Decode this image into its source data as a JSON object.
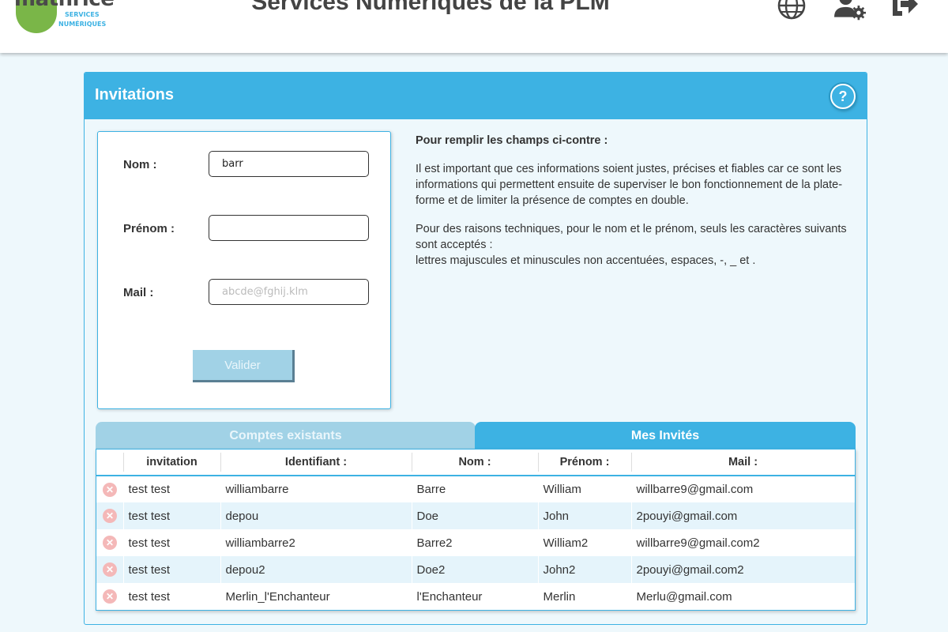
{
  "header": {
    "logo_brand": "mathrice",
    "logo_sub1": "SERVICES",
    "logo_sub2": "NUMÉRIQUES",
    "title": "Services Numériques de la PLM",
    "icons": [
      "globe-icon",
      "user-settings-icon",
      "logout-icon"
    ]
  },
  "panel": {
    "title": "Invitations",
    "help_label": "?"
  },
  "form": {
    "nom_label": "Nom :",
    "nom_value": "barr",
    "prenom_label": "Prénom :",
    "prenom_value": "",
    "mail_label": "Mail :",
    "mail_placeholder": "abcde@fghij.klm",
    "submit_label": "Valider"
  },
  "info": {
    "title": "Pour remplir les champs ci-contre :",
    "paragraph1": "Il est important que ces informations soient justes, précises et fiables car ce sont les informations qui permettent ensuite de superviser le bon fonctionnement de la plate-forme et de limiter la présence de comptes en double.",
    "paragraph2_line1": "Pour des raisons techniques, pour le nom et le prénom, seuls les caractères suivants sont acceptés :",
    "paragraph2_line2": "lettres majuscules et minuscules non accentuées, espaces, -, _ et ."
  },
  "tabs": [
    {
      "label": "Comptes existants",
      "active": false
    },
    {
      "label": "Mes Invités",
      "active": true
    }
  ],
  "table": {
    "columns": [
      "",
      "invitation",
      "Identifiant :",
      "Nom :",
      "Prénom :",
      "Mail :"
    ],
    "rows": [
      {
        "invitation": "test test",
        "identifiant": "williambarre",
        "nom": "Barre",
        "prenom": "William",
        "mail": "willbarre9@gmail.com"
      },
      {
        "invitation": "test test",
        "identifiant": "depou",
        "nom": "Doe",
        "prenom": "John",
        "mail": "2pouyi@gmail.com"
      },
      {
        "invitation": "test test",
        "identifiant": "williambarre2",
        "nom": "Barre2",
        "prenom": "William2",
        "mail": "willbarre9@gmail.com2"
      },
      {
        "invitation": "test test",
        "identifiant": "depou2",
        "nom": "Doe2",
        "prenom": "John2",
        "mail": "2pouyi@gmail.com2"
      },
      {
        "invitation": "test test",
        "identifiant": "Merlin_l'Enchanteur",
        "nom": "l'Enchanteur",
        "prenom": "Merlin",
        "mail": "Merlu@gmail.com"
      }
    ]
  },
  "colors": {
    "accent": "#3db2e3",
    "accent_light": "#a1d2e6",
    "row_alt": "#e5f4fb",
    "logo_green": "#7ab648",
    "delete_icon": "#f4b8b8"
  }
}
